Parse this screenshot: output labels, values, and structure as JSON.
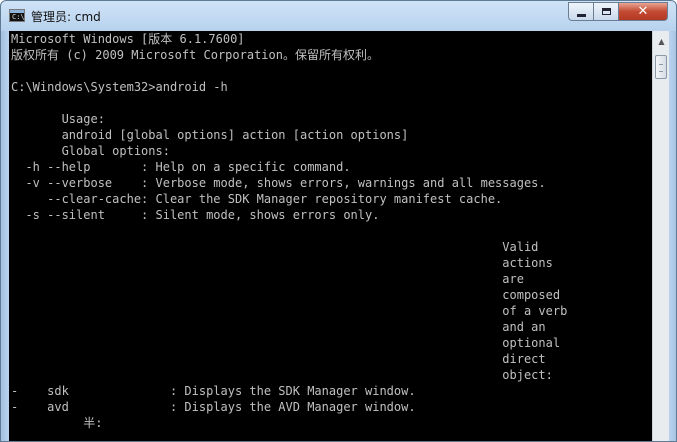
{
  "window": {
    "title": "管理员: cmd",
    "app_icon_glyph": "C:\\",
    "minimize_label": "",
    "maximize_label": "",
    "close_label": "✕"
  },
  "console": {
    "lines": [
      "Microsoft Windows [版本 6.1.7600]",
      "版权所有 (c) 2009 Microsoft Corporation。保留所有权利。",
      "",
      "C:\\Windows\\System32>android -h",
      "",
      "       Usage:",
      "       android [global options] action [action options]",
      "       Global options:",
      "  -h --help       : Help on a specific command.",
      "  -v --verbose    : Verbose mode, shows errors, warnings and all messages.",
      "     --clear-cache: Clear the SDK Manager repository manifest cache.",
      "  -s --silent     : Silent mode, shows errors only.",
      "",
      "                                                                    Valid",
      "                                                                    actions",
      "                                                                    are",
      "                                                                    composed",
      "                                                                    of a verb",
      "                                                                    and an",
      "                                                                    optional",
      "                                                                    direct",
      "                                                                    object:",
      "-    sdk              : Displays the SDK Manager window.",
      "-    avd              : Displays the AVD Manager window.",
      "          半:"
    ]
  },
  "colors": {
    "console_bg": "#000000",
    "console_text": "#c0c0c0",
    "title_bar": "#b9d3ee",
    "close_button": "#c44a33"
  }
}
